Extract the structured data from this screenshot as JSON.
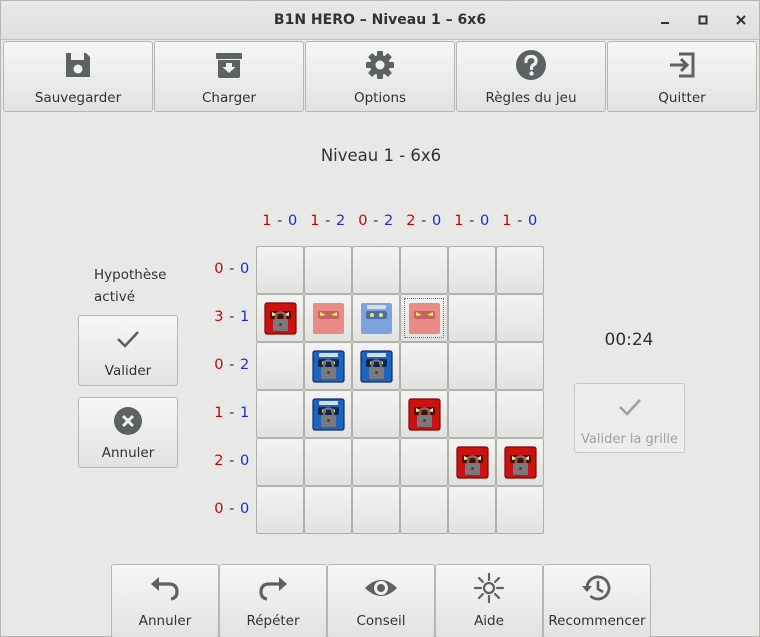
{
  "window": {
    "title": "B1N HERO – Niveau 1 – 6x6",
    "controls": [
      "minimize-icon",
      "maximize-icon",
      "close-icon"
    ]
  },
  "toolbar": {
    "save_label": "Sauvegarder",
    "load_label": "Charger",
    "options_label": "Options",
    "rules_label": "Règles du jeu",
    "quit_label": "Quitter"
  },
  "level_title": "Niveau 1 - 6x6",
  "column_counts": [
    {
      "red": "1",
      "sep": " - ",
      "blue": "0"
    },
    {
      "red": "1",
      "sep": " - ",
      "blue": "2"
    },
    {
      "red": "0",
      "sep": " - ",
      "blue": "2"
    },
    {
      "red": "2",
      "sep": " - ",
      "blue": "0"
    },
    {
      "red": "1",
      "sep": " - ",
      "blue": "0"
    },
    {
      "red": "1",
      "sep": " - ",
      "blue": "0"
    }
  ],
  "row_counts": [
    {
      "red": "0",
      "sep": " - ",
      "blue": "0"
    },
    {
      "red": "3",
      "sep": " - ",
      "blue": "1"
    },
    {
      "red": "0",
      "sep": " - ",
      "blue": "2"
    },
    {
      "red": "1",
      "sep": " - ",
      "blue": "1"
    },
    {
      "red": "2",
      "sep": " - ",
      "blue": "0"
    },
    {
      "red": "0",
      "sep": " - ",
      "blue": "0"
    }
  ],
  "grid": {
    "cells": [
      [
        "",
        "",
        "",
        "",
        "",
        ""
      ],
      [
        "red-locked",
        "red-hypothesis",
        "blue-hypothesis",
        "red-hypothesis",
        "",
        ""
      ],
      [
        "",
        "blue-locked",
        "blue-locked",
        "",
        "",
        ""
      ],
      [
        "",
        "blue-locked",
        "",
        "red-locked",
        "",
        ""
      ],
      [
        "",
        "",
        "",
        "",
        "red-locked",
        "red-locked"
      ],
      [
        "",
        "",
        "",
        "",
        "",
        ""
      ]
    ],
    "selected": {
      "row": 1,
      "col": 3
    },
    "colors": {
      "red": "#cc1111",
      "blue": "#1e63c0",
      "red_light": "#e98a86",
      "blue_light": "#7ea3dc"
    }
  },
  "hypothesis": {
    "label": "Hypothèse activé",
    "validate_label": "Valider",
    "cancel_label": "Annuler"
  },
  "timer": "00:24",
  "validate_grid_label": "Valider la grille",
  "bottom_toolbar": {
    "undo_label": "Annuler",
    "redo_label": "Répéter",
    "hint_label": "Conseil",
    "help_label": "Aide",
    "restart_label": "Recommencer"
  }
}
